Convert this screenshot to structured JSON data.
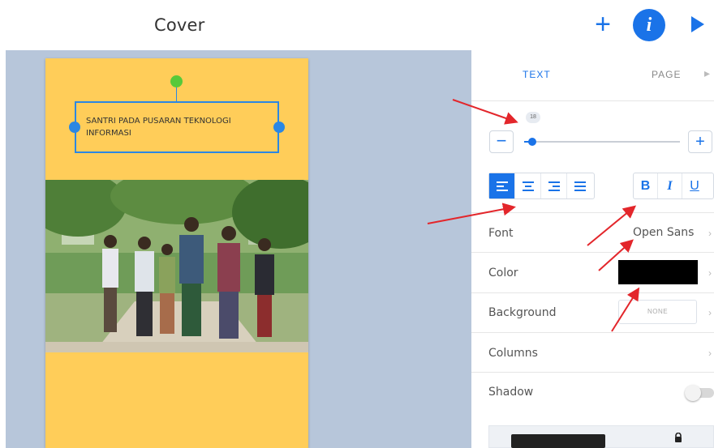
{
  "header": {
    "title": "Cover",
    "add_icon": "plus-icon",
    "info_icon": "info-icon",
    "play_icon": "play-icon"
  },
  "canvas": {
    "text_box": {
      "text": "SANTRI PADA PUSARAN TEKNOLOGI INFORMASI"
    },
    "cover_color": "#ffcd59",
    "selection_color": "#2b87e3",
    "rotate_handle_color": "#57c93a"
  },
  "panel": {
    "tabs": [
      {
        "label": "TEXT",
        "active": true
      },
      {
        "label": "PAGE",
        "active": false
      }
    ],
    "font_size": {
      "value": "18",
      "minus_label": "−",
      "plus_label": "+",
      "level": 0.05
    },
    "alignment": {
      "options": [
        "left",
        "center",
        "right",
        "justify"
      ],
      "selected": "left"
    },
    "styles": {
      "bold": "B",
      "italic": "I",
      "underline": "U"
    },
    "rows": {
      "font": {
        "label": "Font",
        "value": "Open Sans"
      },
      "color": {
        "label": "Color",
        "value": "#000000"
      },
      "background": {
        "label": "Background",
        "value": "NONE"
      },
      "columns": {
        "label": "Columns"
      },
      "shadow": {
        "label": "Shadow",
        "enabled": false
      }
    },
    "accent": "#1a73e8"
  },
  "annotations": {
    "arrow_color": "#e3262b"
  }
}
